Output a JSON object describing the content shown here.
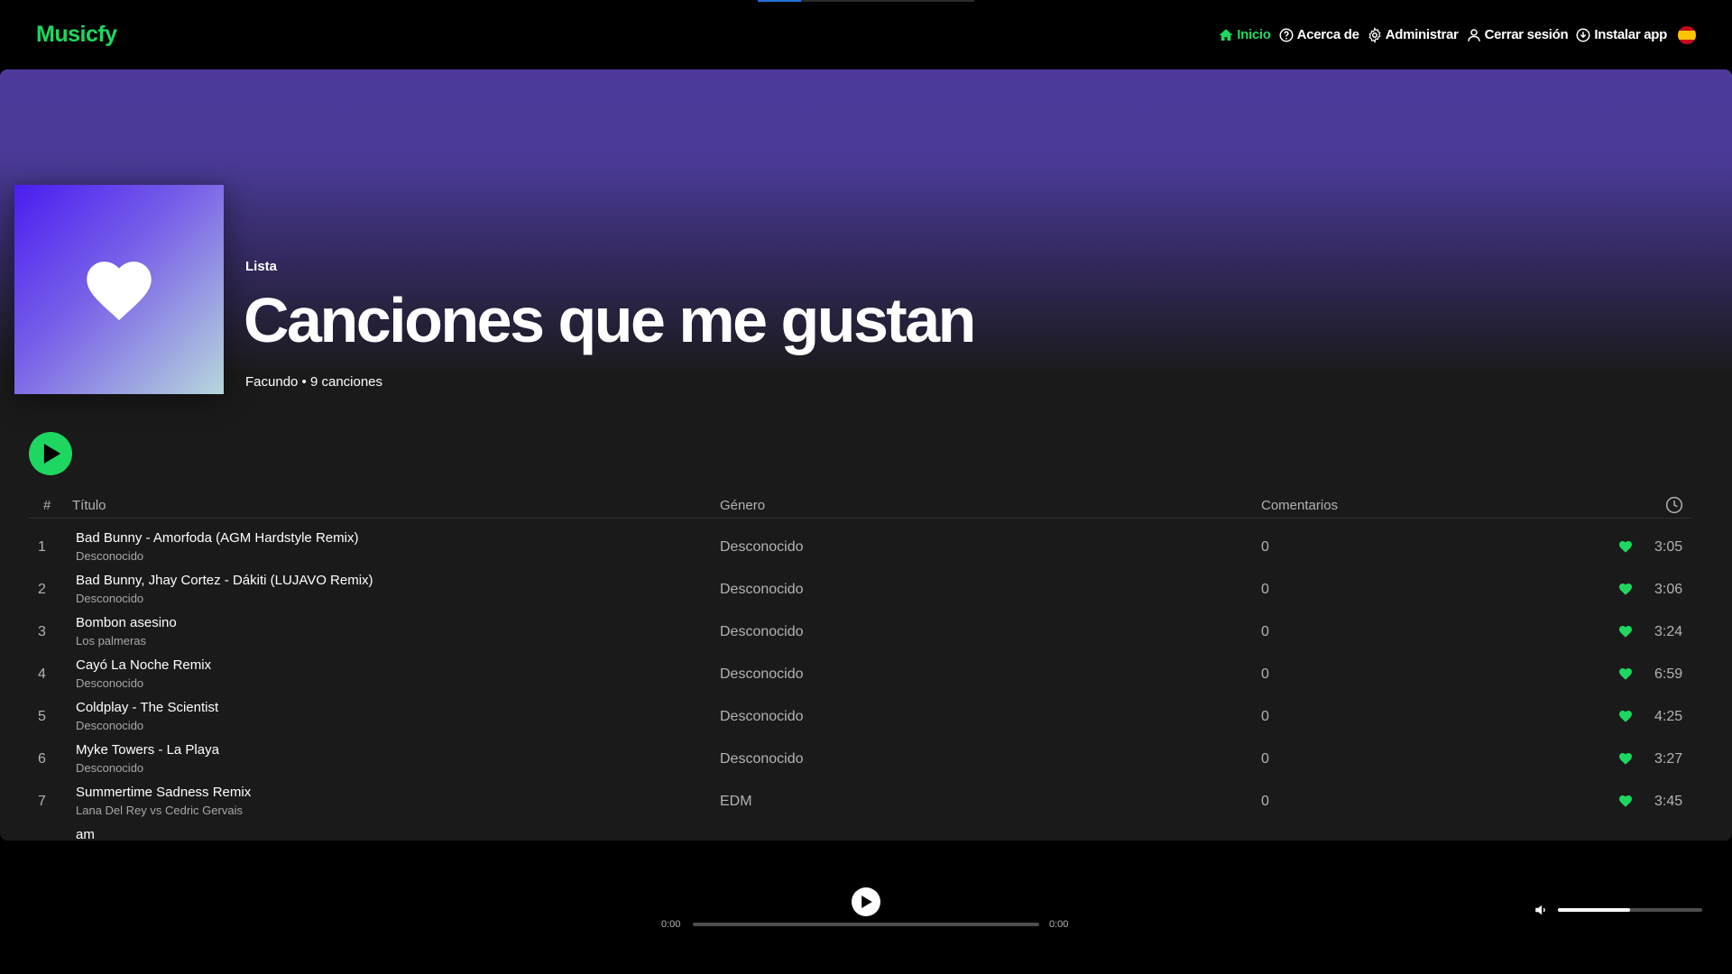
{
  "app": {
    "name": "Musicfy"
  },
  "nav": [
    {
      "label": "Inicio",
      "icon": "home-icon",
      "active": true
    },
    {
      "label": "Acerca de",
      "icon": "question-icon",
      "active": false
    },
    {
      "label": "Administrar",
      "icon": "gear-icon",
      "active": false
    },
    {
      "label": "Cerrar sesión",
      "icon": "user-icon",
      "active": false
    },
    {
      "label": "Instalar app",
      "icon": "download-icon",
      "active": false
    }
  ],
  "language_flag": "spain-flag-icon",
  "colors": {
    "accent": "#1ed760",
    "hero_top": "#4f3a9c",
    "panel": "#1a1a1a"
  },
  "playlist": {
    "type_label": "Lista",
    "title": "Canciones que me gustan",
    "meta": "Facundo • 9 canciones",
    "cover_icon": "heart-icon"
  },
  "table": {
    "headers": {
      "number": "#",
      "title": "Título",
      "genre": "Género",
      "comments": "Comentarios",
      "duration_icon": "clock-icon"
    },
    "rows": [
      {
        "n": "1",
        "title": "Bad Bunny - Amorfoda (AGM Hardstyle Remix)",
        "artist": "Desconocido",
        "genre": "Desconocido",
        "comments": "0",
        "duration": "3:05"
      },
      {
        "n": "2",
        "title": "Bad Bunny, Jhay Cortez - Dákiti (LUJAVO Remix)",
        "artist": "Desconocido",
        "genre": "Desconocido",
        "comments": "0",
        "duration": "3:06"
      },
      {
        "n": "3",
        "title": "Bombon asesino",
        "artist": "Los palmeras",
        "genre": "Desconocido",
        "comments": "0",
        "duration": "3:24"
      },
      {
        "n": "4",
        "title": "Cayó La Noche Remix",
        "artist": "Desconocido",
        "genre": "Desconocido",
        "comments": "0",
        "duration": "6:59"
      },
      {
        "n": "5",
        "title": "Coldplay - The Scientist",
        "artist": "Desconocido",
        "genre": "Desconocido",
        "comments": "0",
        "duration": "4:25"
      },
      {
        "n": "6",
        "title": "Myke Towers - La Playa",
        "artist": "Desconocido",
        "genre": "Desconocido",
        "comments": "0",
        "duration": "3:27"
      },
      {
        "n": "7",
        "title": "Summertime Sadness Remix",
        "artist": "Lana Del Rey vs Cedric Gervais",
        "genre": "EDM",
        "comments": "0",
        "duration": "3:45"
      },
      {
        "n": "",
        "title": "am",
        "artist": "",
        "genre": "",
        "comments": "",
        "duration": ""
      }
    ]
  },
  "player": {
    "current_time": "0:00",
    "total_time": "0:00",
    "progress": 0,
    "volume": 0.5
  }
}
